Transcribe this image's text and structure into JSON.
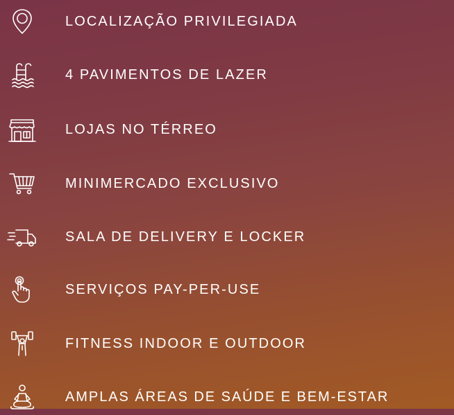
{
  "features": [
    {
      "icon": "location-pin-icon",
      "label": "LOCALIZAÇÃO PRIVILEGIADA"
    },
    {
      "icon": "swimming-pool-icon",
      "label": "4 PAVIMENTOS DE LAZER"
    },
    {
      "icon": "storefront-icon",
      "label": "LOJAS NO TÉRREO"
    },
    {
      "icon": "shopping-cart-icon",
      "label": "MINIMERCADO EXCLUSIVO"
    },
    {
      "icon": "delivery-truck-icon",
      "label": "SALA DE DELIVERY E LOCKER"
    },
    {
      "icon": "touch-hand-icon",
      "label": "SERVIÇOS PAY-PER-USE"
    },
    {
      "icon": "weightlifting-icon",
      "label": "FITNESS INDOOR E OUTDOOR"
    },
    {
      "icon": "meditation-icon",
      "label": "AMPLAS ÁREAS DE SAÚDE E BEM-ESTAR"
    }
  ],
  "colors": {
    "gradient_top": "#7a3447",
    "gradient_bottom": "#a25a24",
    "text": "#ffffff"
  }
}
